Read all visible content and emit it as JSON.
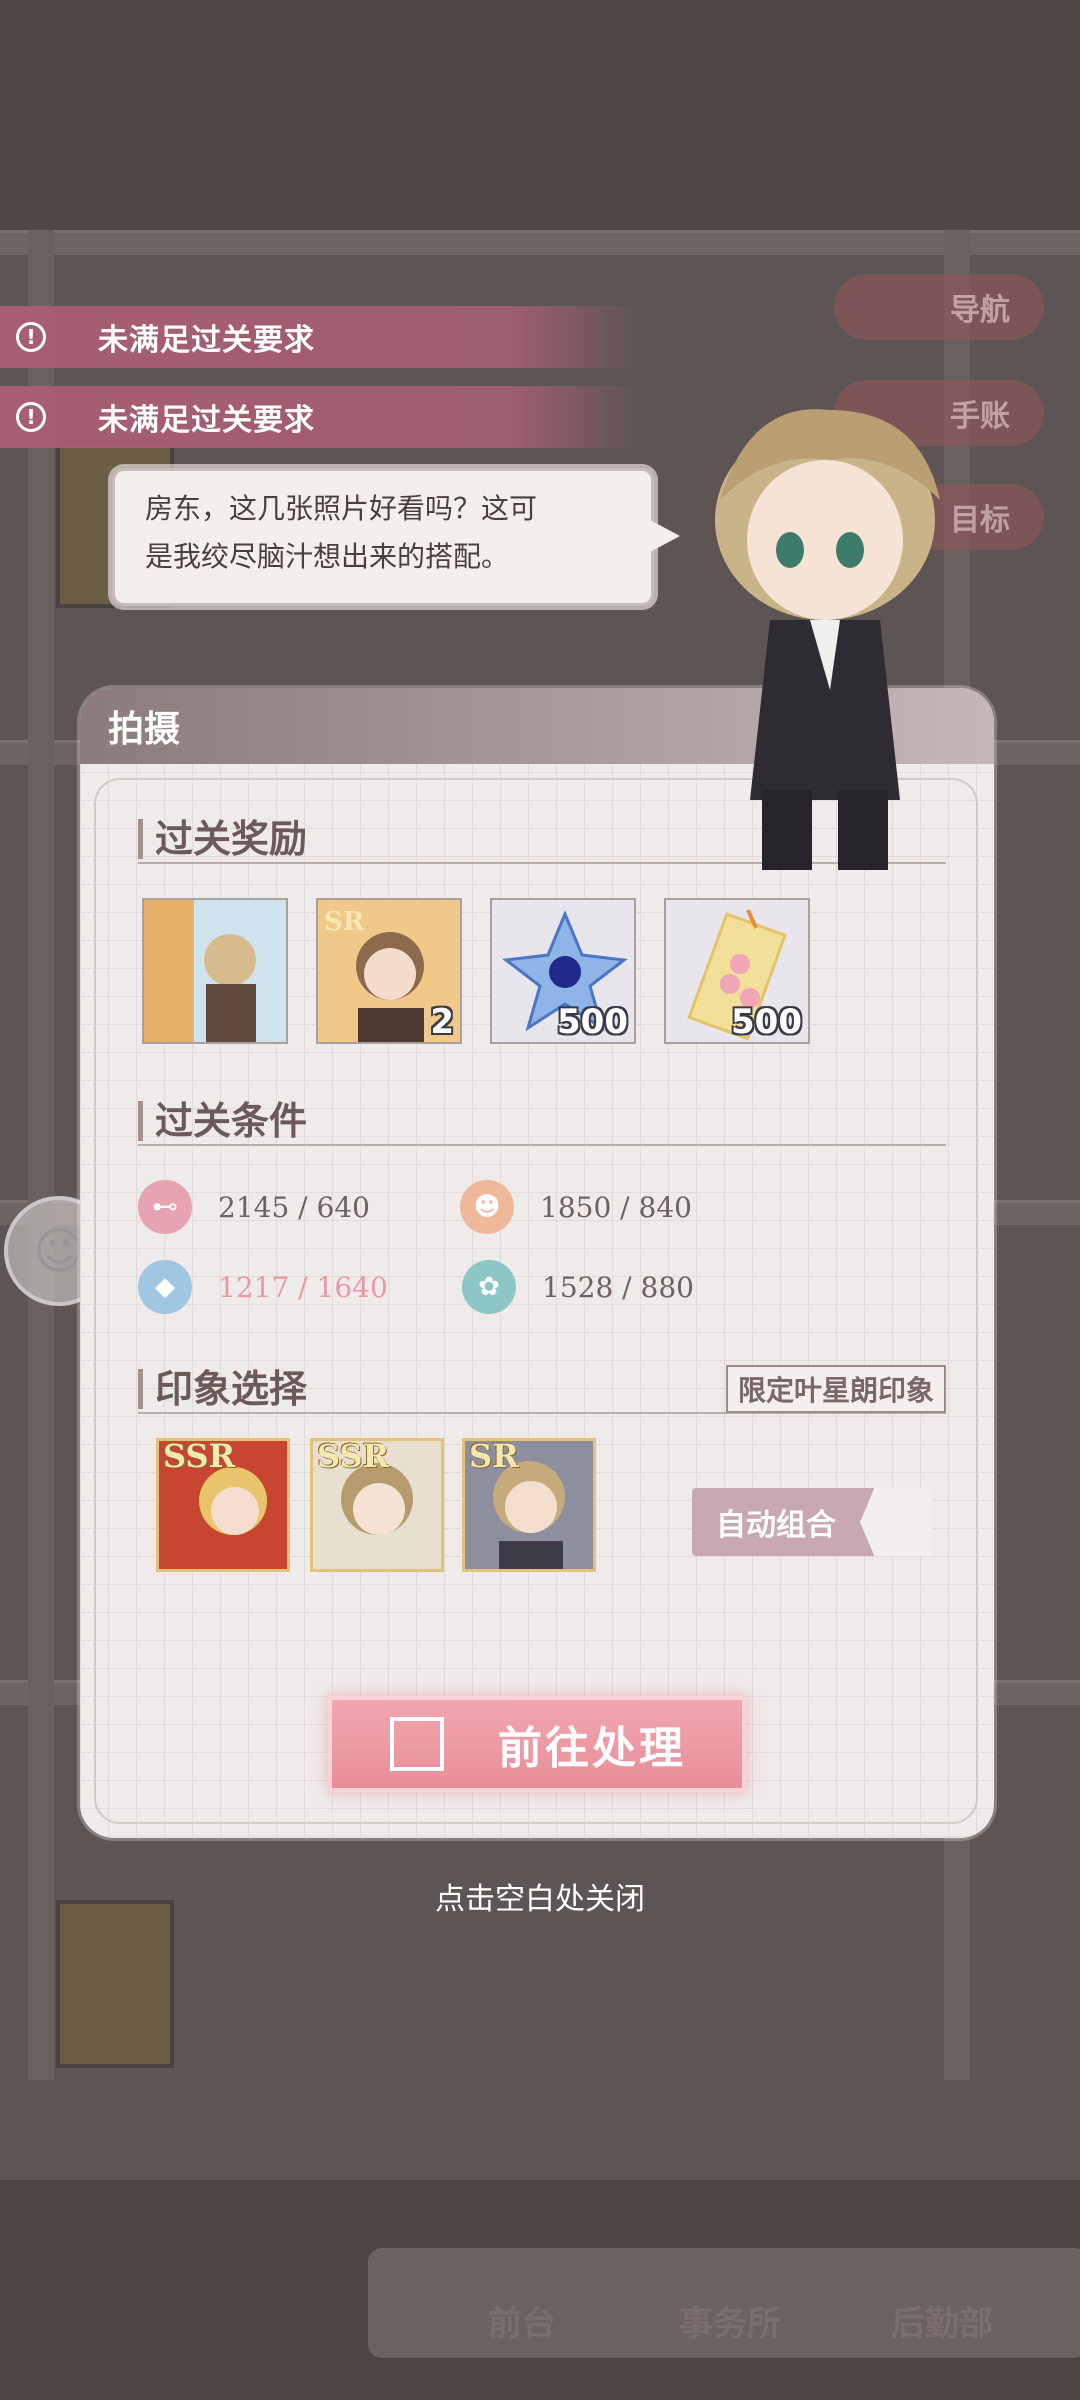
{
  "side_buttons": {
    "navigation": "导航",
    "notebook": "手账",
    "goal": "目标"
  },
  "alerts": [
    {
      "text": "未满足过关要求"
    },
    {
      "text": "未满足过关要求"
    }
  ],
  "dialog": {
    "line1": "房东，这几张照片好看吗？这可",
    "line2": "是我绞尽脑汁想出来的搭配。"
  },
  "panel": {
    "title": "拍摄",
    "rewards_title": "过关奖励",
    "rewards": [
      {
        "name": "photo-card",
        "count": ""
      },
      {
        "name": "sr-card",
        "count": "2"
      },
      {
        "name": "blue-crystal",
        "count": "500"
      },
      {
        "name": "flower-bookmark",
        "count": "500"
      }
    ],
    "conditions_title": "过关条件",
    "conditions": [
      {
        "icon": "dumbbell-icon",
        "current": "2145",
        "required": "/ 640",
        "met": true,
        "color": "#e8a3b3"
      },
      {
        "icon": "person-icon",
        "current": "1850",
        "required": "/ 840",
        "met": true,
        "color": "#f0b89a"
      },
      {
        "icon": "graduation-cap-icon",
        "current": "1217",
        "required": "/ 1640",
        "met": false,
        "color": "#9fc6e3"
      },
      {
        "icon": "flower-icon",
        "current": "1528",
        "required": "/ 880",
        "met": true,
        "color": "#8cc7c6"
      }
    ],
    "impression_title": "印象选择",
    "impression_limit": "限定叶星朗印象",
    "cards": [
      {
        "rank": "SSR"
      },
      {
        "rank": "SSR"
      },
      {
        "rank": "SR"
      }
    ],
    "auto_button": "自动组合",
    "go_button": "前往处理"
  },
  "close_hint": "点击空白处关闭",
  "bottom_nav": {
    "front_desk": "前台",
    "office": "事务所",
    "logistics": "后勤部"
  }
}
